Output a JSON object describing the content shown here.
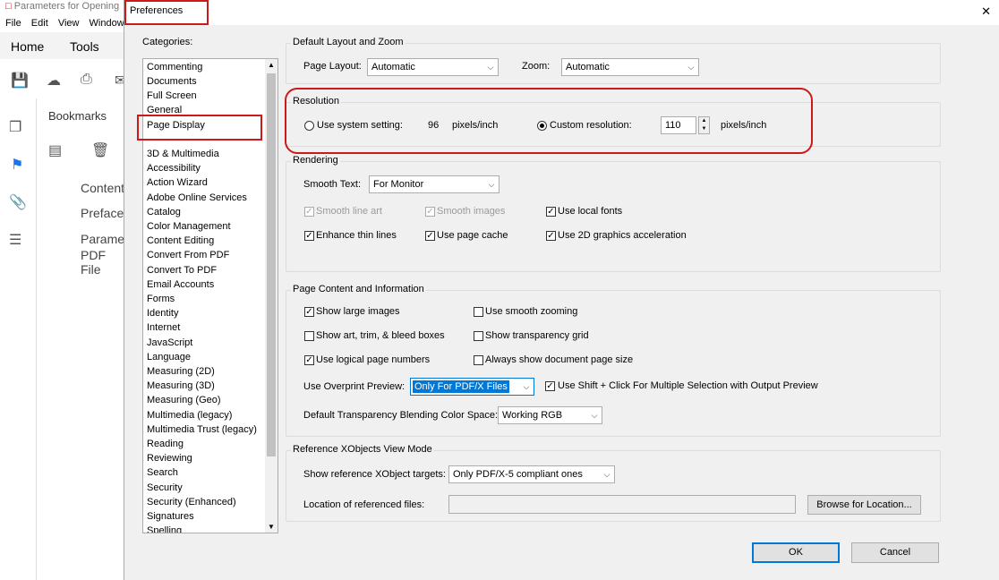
{
  "app": {
    "title": "Parameters for Opening",
    "menu": [
      "File",
      "Edit",
      "View",
      "Window"
    ],
    "tabs": [
      "Home",
      "Tools"
    ],
    "sidebar_heading": "Bookmarks",
    "bookmarks": [
      "Content",
      "Preface",
      "Paramet",
      "PDF File"
    ]
  },
  "dialog": {
    "title": "Preferences",
    "close": "✕",
    "categories_label": "Categories:",
    "categories_top": [
      "Commenting",
      "Documents",
      "Full Screen",
      "General",
      "Page Display"
    ],
    "categories": [
      "3D & Multimedia",
      "Accessibility",
      "Action Wizard",
      "Adobe Online Services",
      "Catalog",
      "Color Management",
      "Content Editing",
      "Convert From PDF",
      "Convert To PDF",
      "Email Accounts",
      "Forms",
      "Identity",
      "Internet",
      "JavaScript",
      "Language",
      "Measuring (2D)",
      "Measuring (3D)",
      "Measuring (Geo)",
      "Multimedia (legacy)",
      "Multimedia Trust (legacy)",
      "Reading",
      "Reviewing",
      "Search",
      "Security",
      "Security (Enhanced)",
      "Signatures",
      "Spelling"
    ],
    "layout_zoom": {
      "title": "Default Layout and Zoom",
      "page_layout_label": "Page Layout:",
      "page_layout_value": "Automatic",
      "zoom_label": "Zoom:",
      "zoom_value": "Automatic"
    },
    "resolution": {
      "title": "Resolution",
      "system_label": "Use system setting:",
      "system_value": "96",
      "system_unit": "pixels/inch",
      "custom_label": "Custom resolution:",
      "custom_value": "110",
      "custom_unit": "pixels/inch"
    },
    "rendering": {
      "title": "Rendering",
      "smooth_text_label": "Smooth Text:",
      "smooth_text_value": "For Monitor",
      "smooth_line_art": "Smooth line art",
      "smooth_images": "Smooth images",
      "use_local_fonts": "Use local fonts",
      "enhance_thin_lines": "Enhance thin lines",
      "use_page_cache": "Use page cache",
      "use_2d_accel": "Use 2D graphics acceleration"
    },
    "page_content": {
      "title": "Page Content and Information",
      "show_large_images": "Show large images",
      "use_smooth_zooming": "Use smooth zooming",
      "show_art_trim": "Show art, trim, & bleed boxes",
      "show_transparency_grid": "Show transparency grid",
      "use_logical_page_numbers": "Use logical page numbers",
      "always_show_doc_page_size": "Always show document page size",
      "overprint_label": "Use Overprint Preview:",
      "overprint_value": "Only For PDF/X Files",
      "shift_click": "Use Shift + Click For Multiple Selection with Output Preview",
      "blending_label": "Default Transparency Blending Color Space:",
      "blending_value": "Working RGB"
    },
    "xobjects": {
      "title": "Reference XObjects View Mode",
      "show_targets_label": "Show reference XObject targets:",
      "show_targets_value": "Only PDF/X-5 compliant ones",
      "location_label": "Location of referenced files:",
      "location_value": "",
      "browse_button": "Browse for Location..."
    },
    "ok_button": "OK",
    "cancel_button": "Cancel"
  }
}
